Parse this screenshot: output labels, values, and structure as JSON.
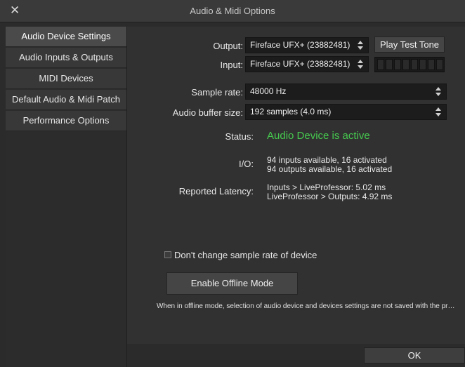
{
  "window": {
    "title": "Audio & Midi Options",
    "close_glyph": "✕"
  },
  "sidebar": {
    "items": [
      {
        "label": "Audio Device Settings",
        "active": true
      },
      {
        "label": "Audio Inputs & Outputs",
        "active": false
      },
      {
        "label": "MIDI Devices",
        "active": false
      },
      {
        "label": "Default Audio & Midi Patch",
        "active": false
      },
      {
        "label": "Performance Options",
        "active": false
      }
    ]
  },
  "device": {
    "output_label": "Output:",
    "output_value": "Fireface UFX+ (23882481)",
    "play_test_tone": "Play Test Tone",
    "input_label": "Input:",
    "input_value": "Fireface UFX+ (23882481)",
    "sample_rate_label": "Sample rate:",
    "sample_rate_value": "48000 Hz",
    "buffer_label": "Audio buffer size:",
    "buffer_value": "192 samples (4.0 ms)"
  },
  "status": {
    "label": "Status:",
    "value": "Audio Device is active",
    "color": "#46c94f"
  },
  "io": {
    "label": "I/O:",
    "line1": "94 inputs available, 16 activated",
    "line2": "94 outputs available, 16 activated"
  },
  "latency": {
    "label": "Reported Latency:",
    "line1": "Inputs > LiveProfessor: 5.02 ms",
    "line2": "LiveProfessor > Outputs: 4.92 ms"
  },
  "options": {
    "dont_change_rate_label": "Don't change sample rate of device",
    "dont_change_rate_checked": false,
    "offline_button": "Enable Offline Mode",
    "offline_note": "When in offline mode, selection of audio device and devices settings are not saved with the pr…"
  },
  "footer": {
    "ok_label": "OK"
  }
}
